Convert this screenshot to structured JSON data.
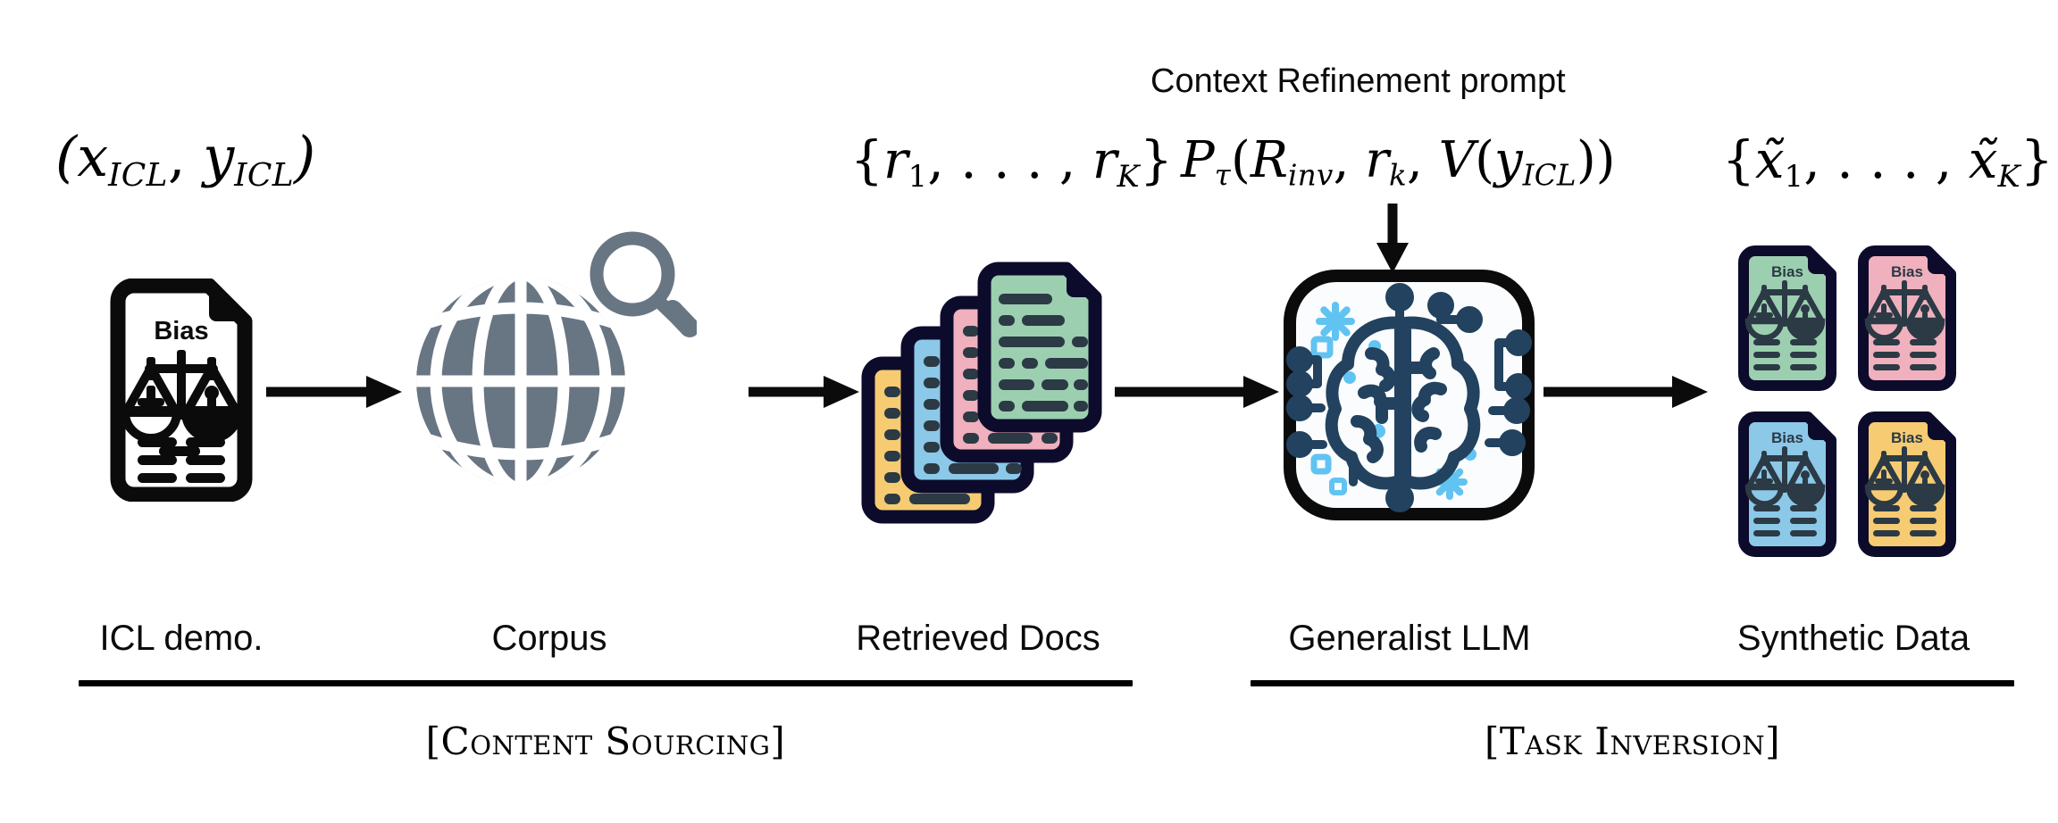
{
  "diagram": {
    "title": "Content Sourcing and Task Inversion pipeline",
    "background": "#ffffff"
  },
  "colors": {
    "ink": "#0b0b0b",
    "globe": "#687583",
    "doc_outline": "#0d0b2b",
    "doc_text": "#2b3a45",
    "green": "#9ccfb0",
    "pink": "#f0b0bd",
    "blue": "#8cc8e8",
    "yellow": "#f6cb72",
    "brain_dark": "#22425f",
    "brain_accent": "#61c3f2"
  },
  "top_labels": {
    "icl_demo": {
      "open": "(",
      "x": "x",
      "x_sub": "ICL",
      "comma": ", ",
      "y": "y",
      "y_sub": "ICL",
      "close": ")"
    },
    "retrieved": {
      "open": "{",
      "r1": "r",
      "r1_sub": "1",
      "dots": ", . . . , ",
      "rk": "r",
      "rk_sub": "K",
      "close": "}"
    },
    "prompt_caption": "Context Refinement prompt",
    "prompt_formula": {
      "p": "ᵋP",
      "p_glyph": "P",
      "tau": "τ",
      "open": "(",
      "r_inv": "R",
      "r_inv_sub": "inv",
      "comma1": ", ",
      "r_k": "r",
      "r_k_sub": "k",
      "comma2": ", ",
      "v": "V",
      "v_open": "(",
      "y": "y",
      "y_sub": "ICL",
      "v_close": ")",
      "close": ")"
    },
    "synthetic": {
      "open": "{",
      "x1": "x̃",
      "x1_sub": "1",
      "dots": ", . . . , ",
      "xk": "x̃",
      "xk_sub": "K",
      "close": "}"
    }
  },
  "stage_captions": [
    {
      "id": "icl-demo",
      "label": "ICL demo."
    },
    {
      "id": "corpus",
      "label": "Corpus"
    },
    {
      "id": "retrieved-docs",
      "label": "Retrieved Docs"
    },
    {
      "id": "generalist-llm",
      "label": "Generalist LLM"
    },
    {
      "id": "synthetic-data",
      "label": "Synthetic Data"
    }
  ],
  "phases": [
    {
      "id": "content-sourcing",
      "label": "[Content Sourcing]"
    },
    {
      "id": "task-inversion",
      "label": "[Task Inversion]"
    }
  ],
  "icons": {
    "source_doc_title": "Bias",
    "synthetic_docs": [
      {
        "title": "Bias",
        "color": "#9ccfb0",
        "name": "synthetic-doc-green"
      },
      {
        "title": "Bias",
        "color": "#f0b0bd",
        "name": "synthetic-doc-pink"
      },
      {
        "title": "Bias",
        "color": "#8cc8e8",
        "name": "synthetic-doc-blue"
      },
      {
        "title": "Bias",
        "color": "#f6cb72",
        "name": "synthetic-doc-yellow"
      }
    ],
    "retrieved_stack": [
      {
        "color": "#f6cb72",
        "name": "retrieved-doc-yellow"
      },
      {
        "color": "#8cc8e8",
        "name": "retrieved-doc-blue"
      },
      {
        "color": "#f0b0bd",
        "name": "retrieved-doc-pink"
      },
      {
        "color": "#9ccfb0",
        "name": "retrieved-doc-green"
      }
    ]
  }
}
